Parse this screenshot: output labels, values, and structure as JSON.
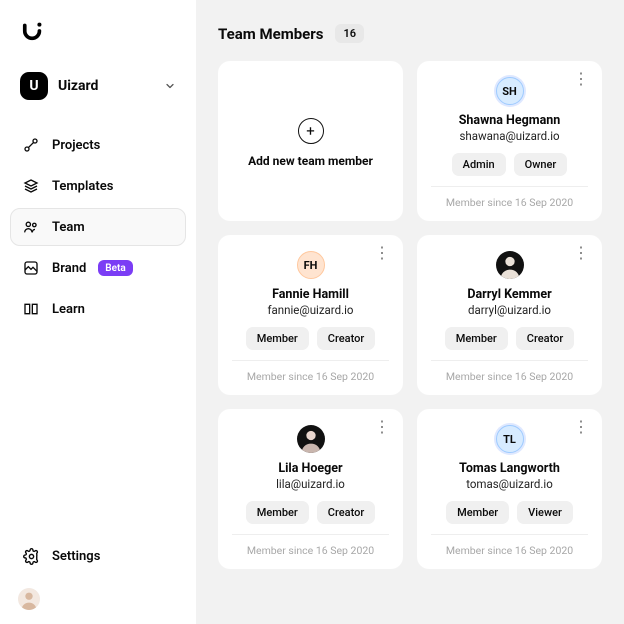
{
  "workspace": {
    "name": "Uizard",
    "icon_letter": "U"
  },
  "nav": {
    "projects": "Projects",
    "templates": "Templates",
    "team": "Team",
    "brand": "Brand",
    "brand_badge": "Beta",
    "learn": "Learn",
    "settings": "Settings"
  },
  "page": {
    "title": "Team Members",
    "count": "16",
    "add_label": "Add new team member"
  },
  "members": [
    {
      "initials": "SH",
      "name": "Shawna Hegmann",
      "email": "shawana@uizard.io",
      "role1": "Admin",
      "role2": "Owner",
      "since": "Member since 16 Sep 2020"
    },
    {
      "initials": "FH",
      "name": "Fannie Hamill",
      "email": "fannie@uizard.io",
      "role1": "Member",
      "role2": "Creator",
      "since": "Member since 16 Sep 2020"
    },
    {
      "name": "Darryl Kemmer",
      "email": "darryl@uizard.io",
      "role1": "Member",
      "role2": "Creator",
      "since": "Member since 16 Sep 2020"
    },
    {
      "name": "Lila Hoeger",
      "email": "lila@uizard.io",
      "role1": "Member",
      "role2": "Creator",
      "since": "Member since 16 Sep 2020"
    },
    {
      "initials": "TL",
      "name": "Tomas Langworth",
      "email": "tomas@uizard.io",
      "role1": "Member",
      "role2": "Viewer",
      "since": "Member since 16 Sep 2020"
    }
  ]
}
